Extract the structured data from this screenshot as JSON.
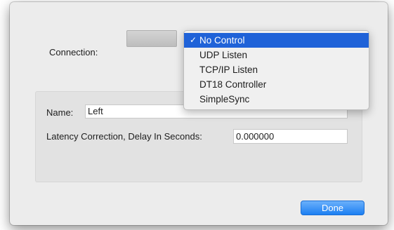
{
  "connection_label": "Connection:",
  "menu": {
    "items": [
      {
        "label": "No Control",
        "selected": true
      },
      {
        "label": "UDP Listen"
      },
      {
        "label": "TCP/IP Listen"
      },
      {
        "label": "DT18 Controller"
      },
      {
        "label": "SimpleSync"
      }
    ],
    "check_glyph": "✓"
  },
  "name_label": "Name:",
  "name_value": "Left",
  "latency_label": "Latency Correction, Delay In Seconds:",
  "latency_value": "0.000000",
  "done_label": "Done",
  "colors": {
    "accent": "#1f62d8",
    "done_button": "#1c7ff2"
  }
}
